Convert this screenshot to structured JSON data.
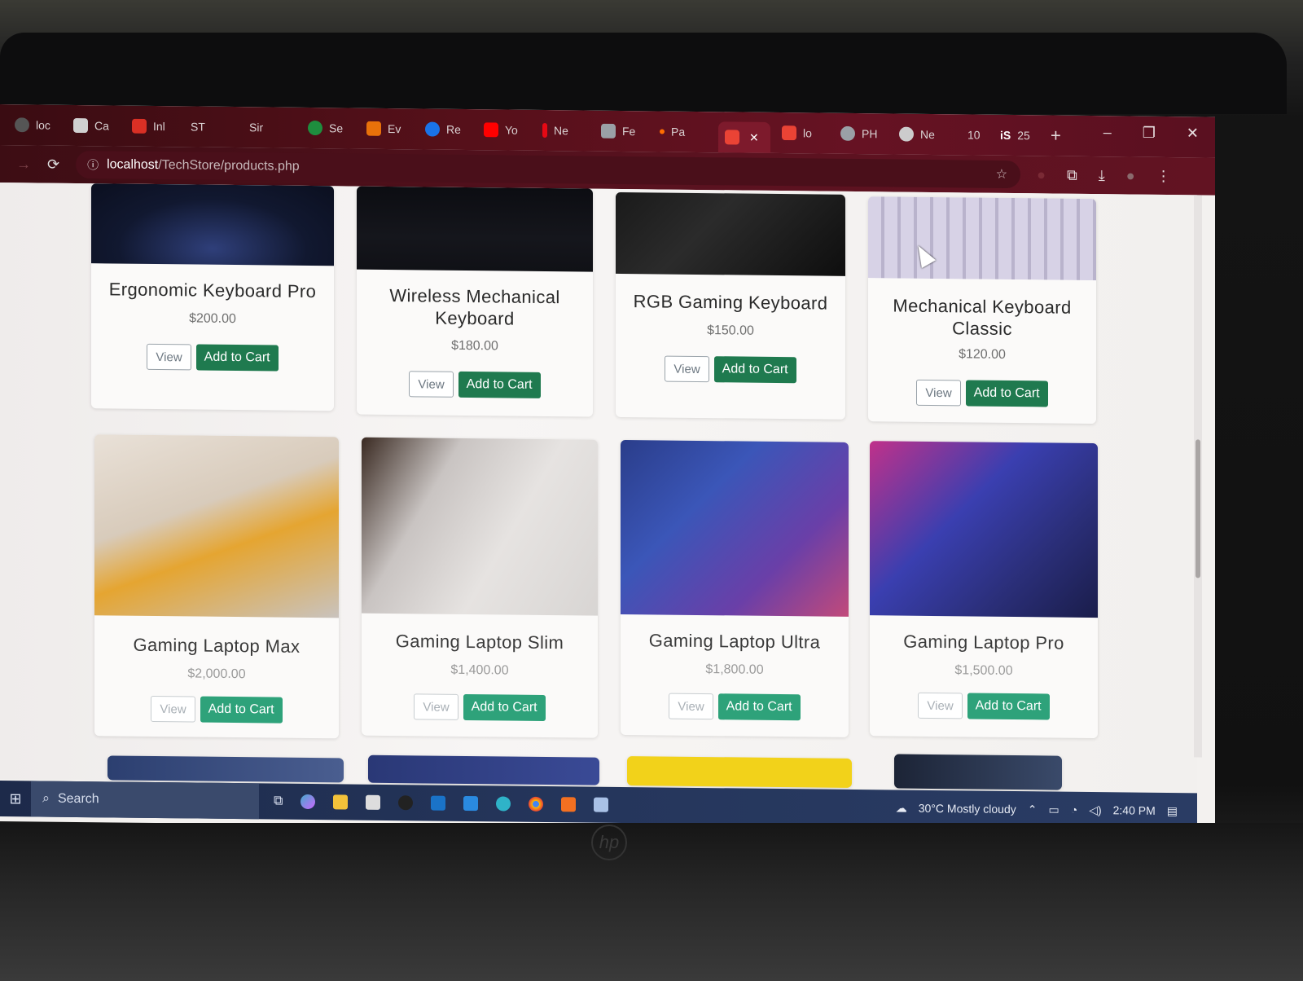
{
  "browser": {
    "tabs": [
      {
        "label": "loc",
        "color": "#555555"
      },
      {
        "label": "Ca",
        "color": "#d0d0d0"
      },
      {
        "label": "Inl",
        "color": "#d93025"
      },
      {
        "label": "ST",
        "color": "#333333"
      },
      {
        "label": "Sir",
        "color": "#333333"
      },
      {
        "label": "Se",
        "color": "#1e8e3e"
      },
      {
        "label": "Ev",
        "color": "#e8710a"
      },
      {
        "label": "Re",
        "color": "#1a73e8"
      },
      {
        "label": "Yo",
        "color": "#ff0000"
      },
      {
        "label": "Ne",
        "color": "#e50914"
      },
      {
        "label": "Fe",
        "color": "#9aa0a6"
      },
      {
        "label": "Pa",
        "color": "#ff6d00"
      },
      {
        "label": "",
        "color": "#ea4335"
      },
      {
        "label": "lo",
        "color": "#ea4335"
      },
      {
        "label": "PH",
        "color": "#9aa0a6"
      },
      {
        "label": "Ne",
        "color": "#cccccc"
      },
      {
        "label": "10",
        "color": "#333333"
      },
      {
        "label": "25",
        "color": "#333333"
      }
    ],
    "url_host": "localhost",
    "url_path": "/TechStore/products.php"
  },
  "products": [
    {
      "name": "Ergonomic Keyboard Pro",
      "price": "$200.00",
      "view": "View",
      "cart": "Add to Cart"
    },
    {
      "name": "Wireless Mechanical Keyboard",
      "price": "$180.00",
      "view": "View",
      "cart": "Add to Cart"
    },
    {
      "name": "RGB Gaming Keyboard",
      "price": "$150.00",
      "view": "View",
      "cart": "Add to Cart"
    },
    {
      "name": "Mechanical Keyboard Classic",
      "price": "$120.00",
      "view": "View",
      "cart": "Add to Cart"
    },
    {
      "name": "Gaming Laptop Max",
      "price": "$2,000.00",
      "view": "View",
      "cart": "Add to Cart"
    },
    {
      "name": "Gaming Laptop Slim",
      "price": "$1,400.00",
      "view": "View",
      "cart": "Add to Cart"
    },
    {
      "name": "Gaming Laptop Ultra",
      "price": "$1,800.00",
      "view": "View",
      "cart": "Add to Cart"
    },
    {
      "name": "Gaming Laptop Pro",
      "price": "$1,500.00",
      "view": "View",
      "cart": "Add to Cart"
    }
  ],
  "taskbar": {
    "search_label": "Search",
    "weather": "30°C  Mostly cloudy",
    "time": "2:40 PM"
  }
}
